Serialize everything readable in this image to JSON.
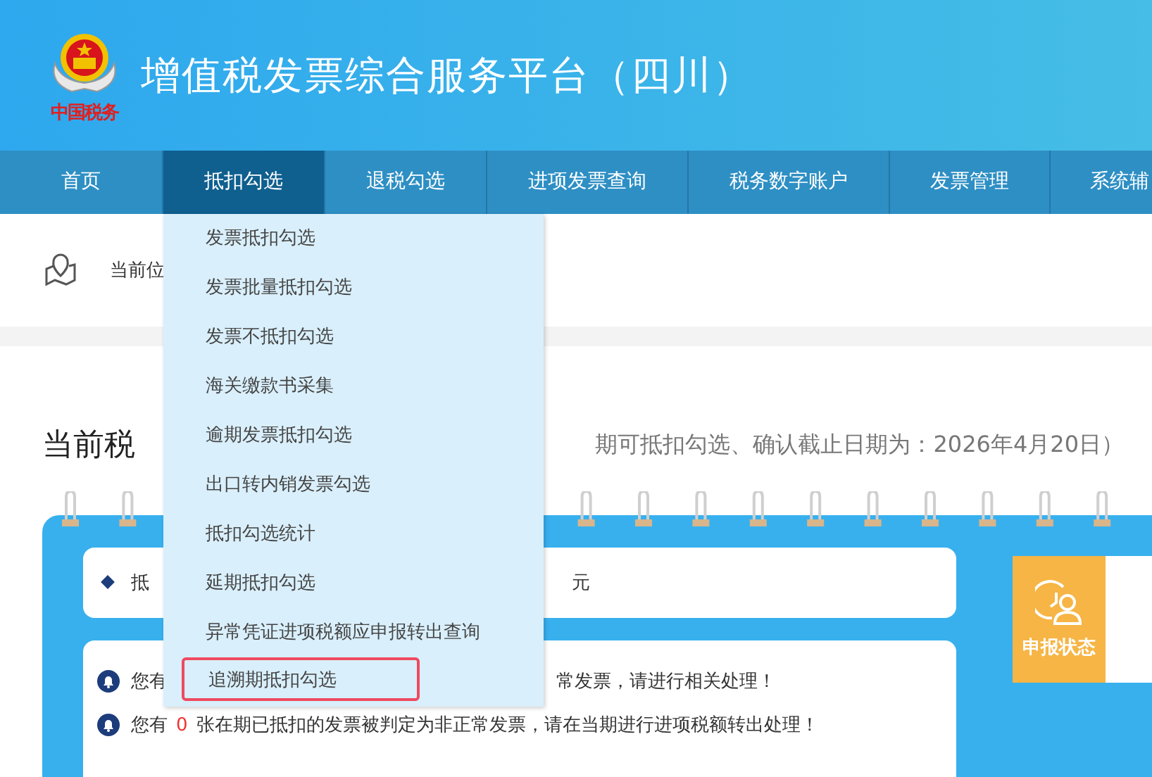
{
  "header": {
    "title": "增值税发票综合服务平台（四川）",
    "logo_caption": "中国税务"
  },
  "nav": [
    {
      "label": "首页",
      "selected": false
    },
    {
      "label": "抵扣勾选",
      "selected": true
    },
    {
      "label": "退税勾选",
      "selected": false
    },
    {
      "label": "进项发票查询",
      "selected": false
    },
    {
      "label": "税务数字账户",
      "selected": false
    },
    {
      "label": "发票管理",
      "selected": false
    },
    {
      "label": "系统辅",
      "selected": false
    }
  ],
  "dropdown": [
    {
      "label": "发票抵扣勾选",
      "selected": false
    },
    {
      "label": "发票批量抵扣勾选",
      "selected": false
    },
    {
      "label": "发票不抵扣勾选",
      "selected": false
    },
    {
      "label": "海关缴款书采集",
      "selected": false
    },
    {
      "label": "逾期发票抵扣勾选",
      "selected": false
    },
    {
      "label": "出口转内销发票勾选",
      "selected": false
    },
    {
      "label": "抵扣勾选统计",
      "selected": false
    },
    {
      "label": "延期抵扣勾选",
      "selected": false
    },
    {
      "label": "异常凭证进项税额应申报转出查询",
      "selected": false
    },
    {
      "label": "追溯期抵扣勾选",
      "selected": true
    }
  ],
  "breadcrumb": {
    "label": "当前位"
  },
  "heading": {
    "title": "当前税",
    "subtitle": "期可抵扣勾选、确认截止日期为：2026年4月20日）"
  },
  "summary": {
    "label": "抵",
    "unit": "元"
  },
  "notices": [
    {
      "parts": [
        "您有",
        "常发票，请进行相关处理！"
      ]
    },
    {
      "parts": [
        "您有",
        "0",
        "张在期已抵扣的发票被判定为非正常发票，请在当期进行进项税额转出处理！"
      ]
    }
  ],
  "side_button": {
    "label": "申报状态"
  }
}
